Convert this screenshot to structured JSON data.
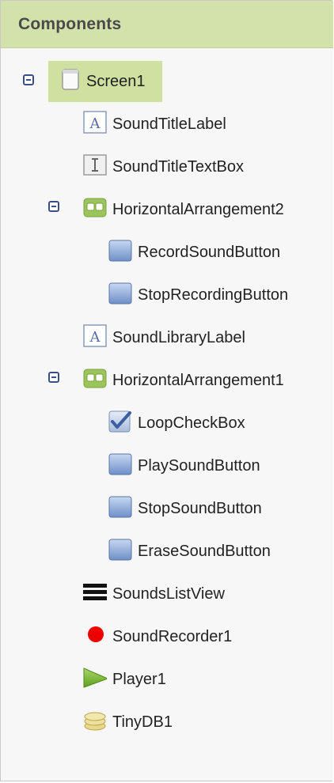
{
  "panel": {
    "title": "Components"
  },
  "tree": {
    "items": [
      {
        "label": "Screen1",
        "icon": "screen-icon",
        "selected": true,
        "collapse_toggle": true
      },
      {
        "label": "SoundTitleLabel",
        "icon": "label-icon"
      },
      {
        "label": "SoundTitleTextBox",
        "icon": "textbox-icon"
      },
      {
        "label": "HorizontalArrangement2",
        "icon": "horizontal-arrangement-icon",
        "collapse_toggle": true
      },
      {
        "label": "RecordSoundButton",
        "icon": "button-icon"
      },
      {
        "label": "StopRecordingButton",
        "icon": "button-icon"
      },
      {
        "label": "SoundLibraryLabel",
        "icon": "label-icon"
      },
      {
        "label": "HorizontalArrangement1",
        "icon": "horizontal-arrangement-icon",
        "collapse_toggle": true
      },
      {
        "label": "LoopCheckBox",
        "icon": "checkbox-icon"
      },
      {
        "label": "PlaySoundButton",
        "icon": "button-icon"
      },
      {
        "label": "StopSoundButton",
        "icon": "button-icon"
      },
      {
        "label": "EraseSoundButton",
        "icon": "button-icon"
      },
      {
        "label": "SoundsListView",
        "icon": "listview-icon"
      },
      {
        "label": "SoundRecorder1",
        "icon": "sound-recorder-icon"
      },
      {
        "label": "Player1",
        "icon": "player-icon"
      },
      {
        "label": "TinyDB1",
        "icon": "database-icon"
      }
    ]
  },
  "colors": {
    "header_bg": "#d2e2aa",
    "selected_bg": "#cfe0a0",
    "toggle": "#3a4f88",
    "recorder_red": "#ee0000",
    "player_green": "#7cbf2c"
  }
}
